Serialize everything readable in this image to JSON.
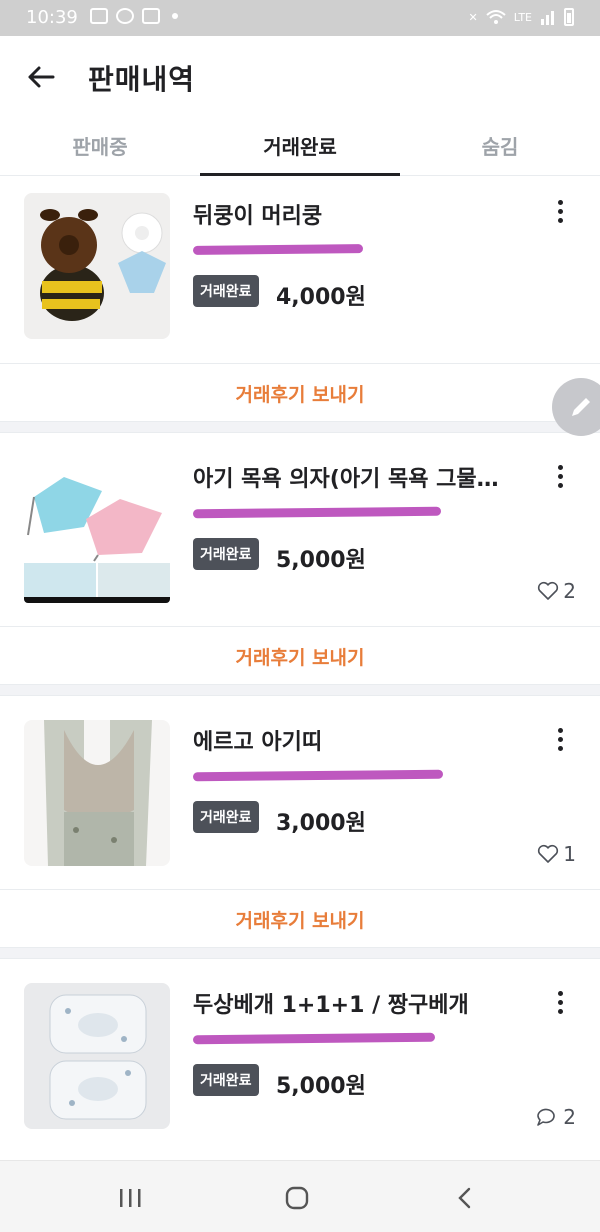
{
  "status_bar": {
    "time": "10:39",
    "network_label": "LTE"
  },
  "header": {
    "title": "판매내역"
  },
  "tabs": [
    {
      "label": "판매중",
      "active": false
    },
    {
      "label": "거래완료",
      "active": true
    },
    {
      "label": "숨김",
      "active": false
    }
  ],
  "items": [
    {
      "title": "뒤쿵이 머리쿵",
      "badge": "거래완료",
      "price": "4,000원",
      "likes": null,
      "chats": null,
      "review_label": "거래후기 보내기"
    },
    {
      "title": "아기 목욕 의자(아기 목욕 그물…",
      "badge": "거래완료",
      "price": "5,000원",
      "likes": "2",
      "chats": null,
      "review_label": "거래후기 보내기"
    },
    {
      "title": "에르고 아기띠",
      "badge": "거래완료",
      "price": "3,000원",
      "likes": "1",
      "chats": null,
      "review_label": "거래후기 보내기"
    },
    {
      "title": "두상베개 1+1+1 / 짱구베개",
      "badge": "거래완료",
      "price": "5,000원",
      "likes": null,
      "chats": "2"
    }
  ],
  "colors": {
    "accent_orange": "#e87d3a",
    "badge_bg": "#4d5159",
    "redaction": "#b33bb4"
  }
}
